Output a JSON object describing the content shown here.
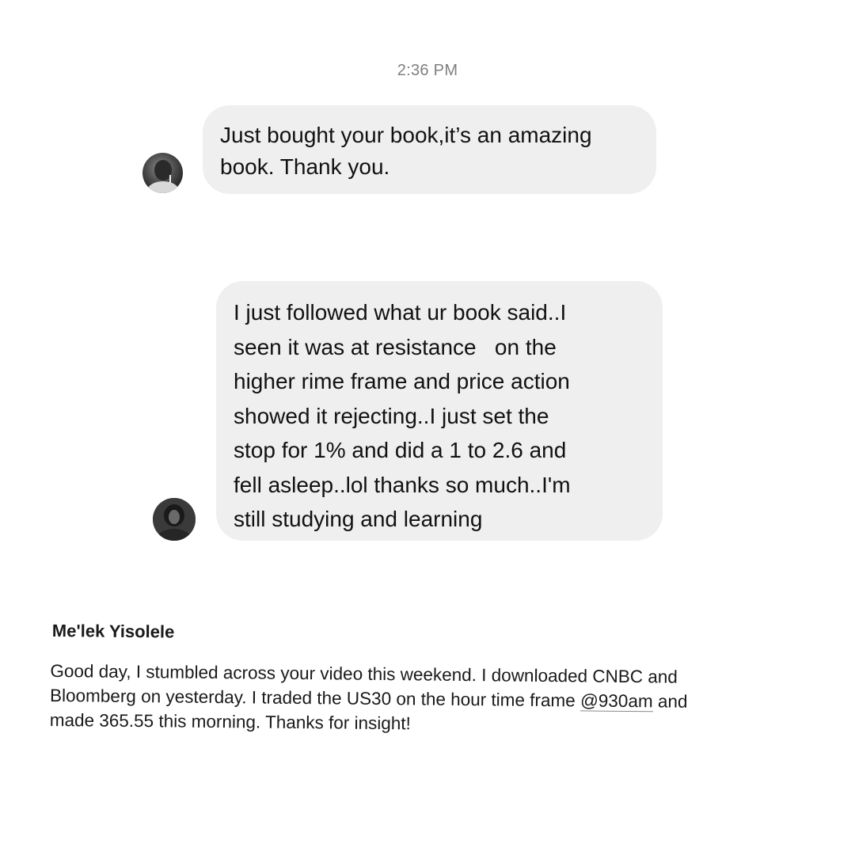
{
  "timestamp": "2:36 PM",
  "messages": [
    {
      "lines": [
        "Just bought your book,it’s an amazing",
        "book. Thank you."
      ]
    },
    {
      "lines": [
        "I just followed what ur book said..I",
        "seen it was at resistance   on the",
        "higher rime frame and price action",
        "showed it rejecting..I just set the",
        "stop for 1% and did a 1 to 2.6 and",
        "fell asleep..lol thanks so much..I'm",
        "still studying and learning"
      ]
    }
  ],
  "email": {
    "sender": "Me'lek Yisolele",
    "line1": "Good day, I stumbled across your video this weekend. I downloaded CNBC and",
    "line2": "Bloomberg on yesterday. I traded the US30 on the hour time frame ",
    "line2_link": "@930am",
    "line2_end": " and",
    "line3": "made 365.55 this morning. Thanks for insight!"
  },
  "colors": {
    "bubble": "#efefef",
    "timestamp": "#7f7f7f",
    "text": "#111111"
  }
}
